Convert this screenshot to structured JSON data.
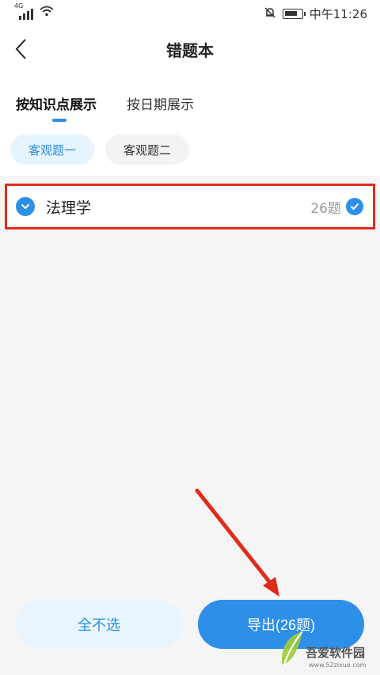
{
  "status_bar": {
    "network": "4G",
    "time": "中午11:26",
    "icons": [
      "signal-icon",
      "wifi-icon",
      "bell-off-icon",
      "battery-icon"
    ]
  },
  "header": {
    "title": "错题本",
    "back_icon": "chevron-left-icon"
  },
  "tabs": [
    {
      "label": "按知识点展示",
      "active": true
    },
    {
      "label": "按日期展示",
      "active": false
    }
  ],
  "chips": [
    {
      "label": "客观题一",
      "active": true
    },
    {
      "label": "客观题二",
      "active": false
    }
  ],
  "subjects": [
    {
      "name": "法理学",
      "count": "26题",
      "selected": true
    }
  ],
  "footer": {
    "deselect_all": "全不选",
    "export": "导出(26题)"
  },
  "watermark": {
    "name": "吾爱软件园",
    "url": "www.52zixue.com"
  },
  "colors": {
    "accent": "#2e8fe8",
    "highlight_border": "#e02a1c",
    "annotation_arrow": "#e02a1c"
  }
}
